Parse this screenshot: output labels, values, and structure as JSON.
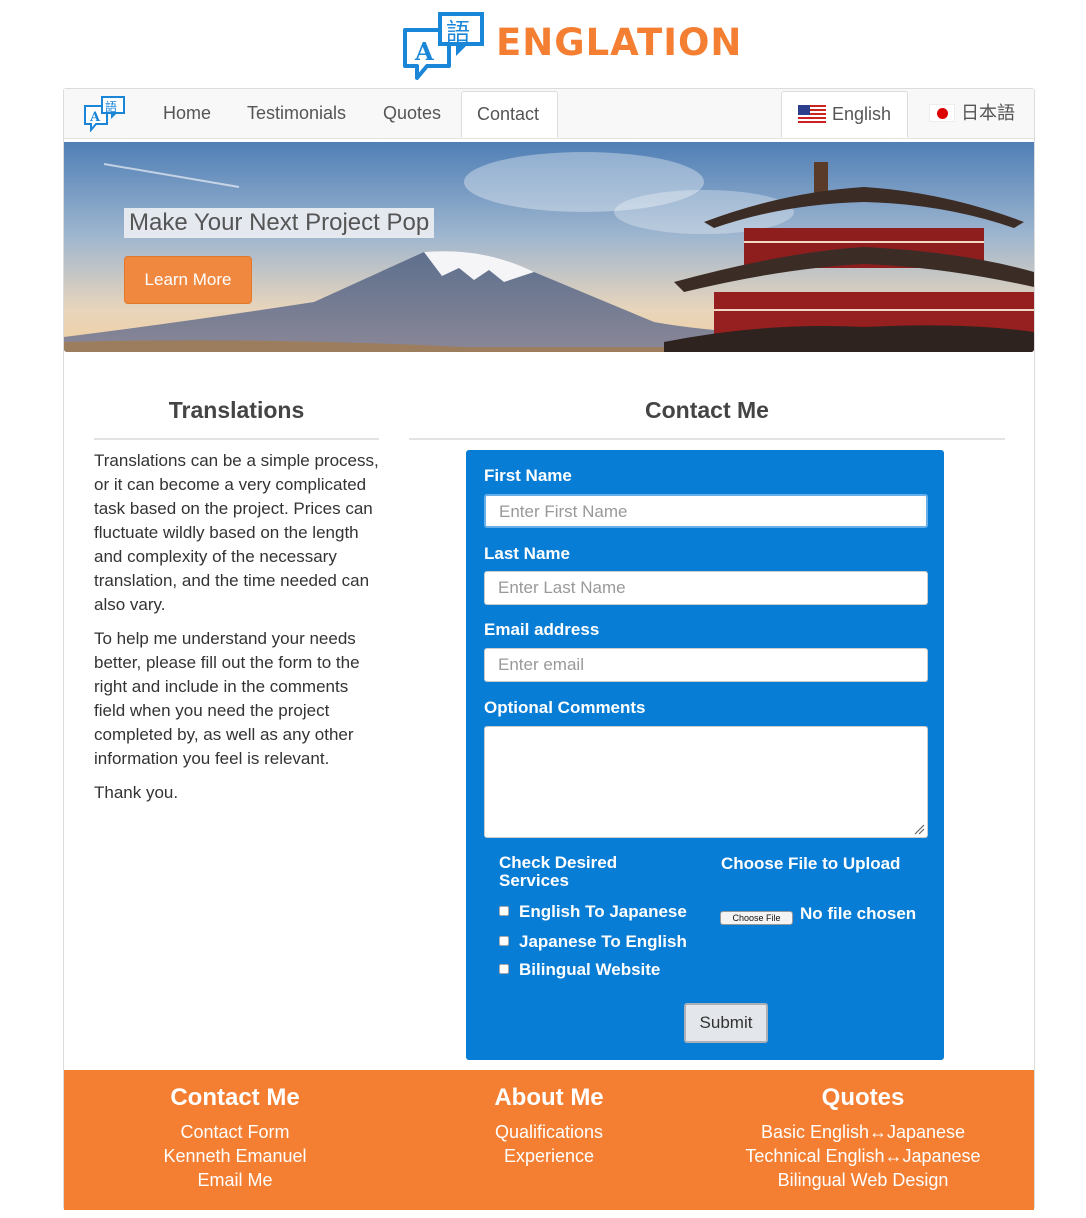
{
  "brand": {
    "name": "ENGLATION",
    "color": "#f47f32"
  },
  "nav": {
    "items": [
      {
        "label": "Home"
      },
      {
        "label": "Testimonials"
      },
      {
        "label": "Quotes"
      },
      {
        "label": "Contact",
        "active": true
      }
    ],
    "languages": [
      {
        "label": "English",
        "flag": "us-flag-icon",
        "active": true
      },
      {
        "label": "日本語",
        "flag": "japan-flag-icon"
      }
    ]
  },
  "hero": {
    "title": "Make Your Next Project Pop",
    "button": "Learn More"
  },
  "translations": {
    "heading": "Translations",
    "paragraphs": [
      "Translations can be a simple process, or it can become a very complicated task based on the project. Prices can fluctuate wildly based on the length and complexity of the necessary translation, and the time needed can also vary.",
      "To help me understand your needs better, please fill out the form to the right and include in the comments field when you need the project completed by, as well as any other information you feel is relevant.",
      "Thank you."
    ]
  },
  "contact": {
    "heading": "Contact Me",
    "form_color": "#087dd6",
    "first_name": {
      "label": "First Name",
      "placeholder": "Enter First Name"
    },
    "last_name": {
      "label": "Last Name",
      "placeholder": "Enter Last Name"
    },
    "email": {
      "label": "Email address",
      "placeholder": "Enter email"
    },
    "comments": {
      "label": "Optional Comments"
    },
    "services": {
      "label": "Check Desired Services",
      "options": [
        "English To Japanese",
        "Japanese To English",
        "Bilingual Website"
      ]
    },
    "file": {
      "label": "Choose File to Upload",
      "button": "Choose File",
      "status": "No file chosen"
    },
    "submit": "Submit"
  },
  "footer": {
    "color": "#f47f32",
    "columns": [
      {
        "title": "Contact Me",
        "links": [
          "Contact Form",
          "Kenneth Emanuel",
          "Email Me"
        ]
      },
      {
        "title": "About Me",
        "links": [
          "Qualifications",
          "Experience"
        ]
      },
      {
        "title": "Quotes",
        "links": [
          "Basic English↔Japanese",
          "Technical English↔Japanese",
          "Bilingual Web Design"
        ]
      }
    ]
  }
}
